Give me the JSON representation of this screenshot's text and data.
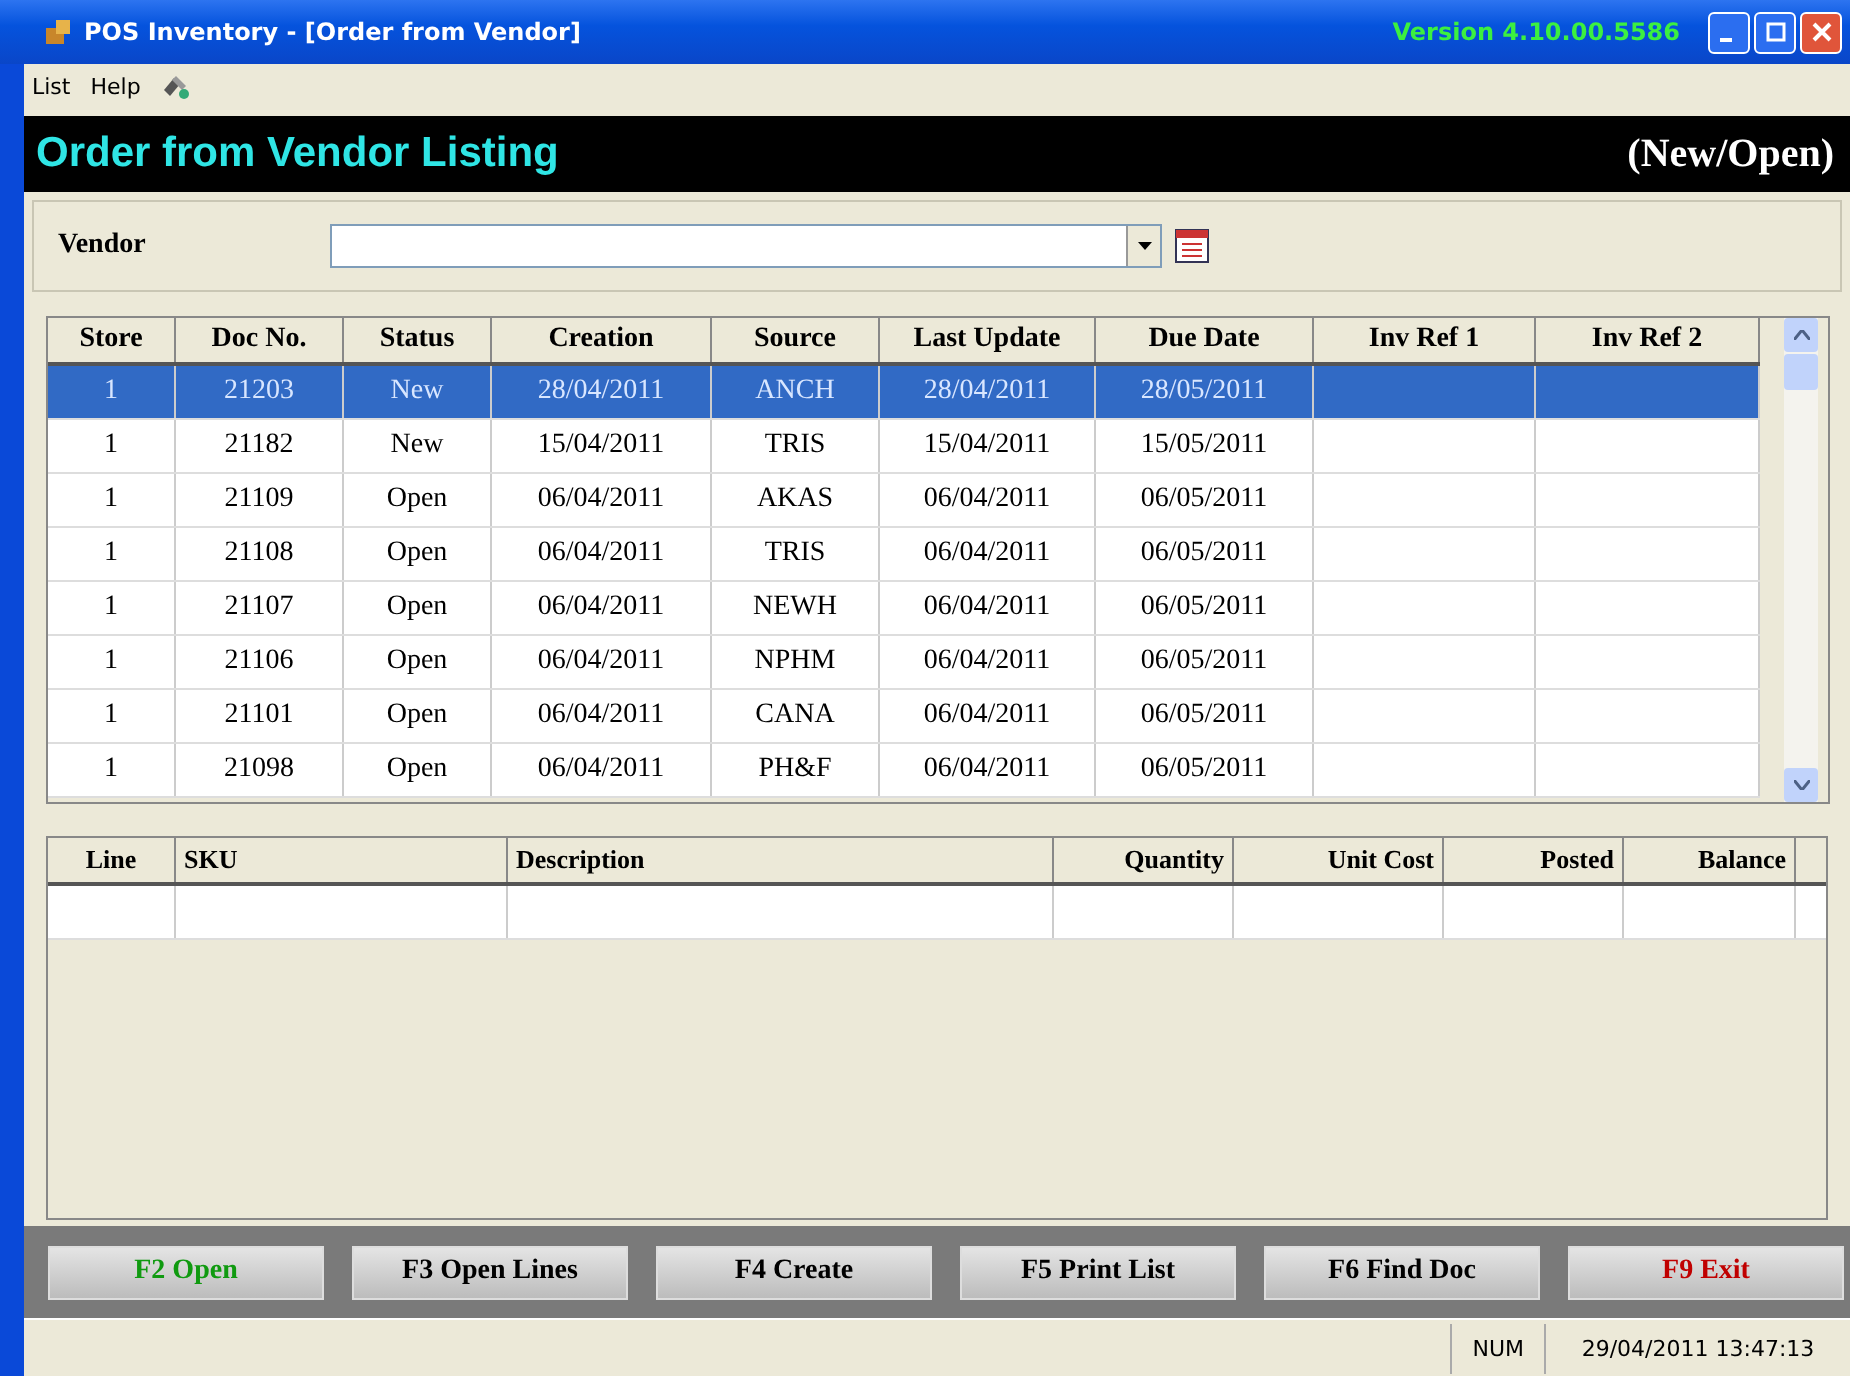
{
  "window": {
    "title": "POS Inventory - [Order from Vendor]",
    "version": "Version 4.10.00.5586"
  },
  "menu": [
    "List",
    "Help"
  ],
  "header": {
    "title": "Order from Vendor Listing",
    "mode": "(New/Open)"
  },
  "vendor": {
    "label": "Vendor"
  },
  "orders": {
    "columns": [
      "Store",
      "Doc No.",
      "Status",
      "Creation",
      "Source",
      "Last Update",
      "Due Date",
      "Inv Ref 1",
      "Inv Ref 2"
    ],
    "rows": [
      {
        "selected": true,
        "cells": [
          "1",
          "21203",
          "New",
          "28/04/2011",
          "ANCH",
          "28/04/2011",
          "28/05/2011"
        ]
      },
      {
        "selected": false,
        "cells": [
          "1",
          "21182",
          "New",
          "15/04/2011",
          "TRIS",
          "15/04/2011",
          "15/05/2011"
        ]
      },
      {
        "selected": false,
        "cells": [
          "1",
          "21109",
          "Open",
          "06/04/2011",
          "AKAS",
          "06/04/2011",
          "06/05/2011"
        ]
      },
      {
        "selected": false,
        "cells": [
          "1",
          "21108",
          "Open",
          "06/04/2011",
          "TRIS",
          "06/04/2011",
          "06/05/2011"
        ]
      },
      {
        "selected": false,
        "cells": [
          "1",
          "21107",
          "Open",
          "06/04/2011",
          "NEWH",
          "06/04/2011",
          "06/05/2011"
        ]
      },
      {
        "selected": false,
        "cells": [
          "1",
          "21106",
          "Open",
          "06/04/2011",
          "NPHM",
          "06/04/2011",
          "06/05/2011"
        ]
      },
      {
        "selected": false,
        "cells": [
          "1",
          "21101",
          "Open",
          "06/04/2011",
          "CANA",
          "06/04/2011",
          "06/05/2011"
        ]
      },
      {
        "selected": false,
        "cells": [
          "1",
          "21098",
          "Open",
          "06/04/2011",
          "PH&F",
          "06/04/2011",
          "06/05/2011"
        ]
      }
    ]
  },
  "lines": {
    "columns": [
      "Line",
      "SKU",
      "Description",
      "Quantity",
      "Unit Cost",
      "Posted",
      "Balance"
    ]
  },
  "buttons": [
    {
      "label": "F2 Open",
      "color": "#109a10"
    },
    {
      "label": "F3 Open Lines",
      "color": "#000000"
    },
    {
      "label": "F4 Create",
      "color": "#000000"
    },
    {
      "label": "F5 Print List",
      "color": "#000000"
    },
    {
      "label": "F6 Find Doc",
      "color": "#000000"
    },
    {
      "label": "F9 Exit",
      "color": "#c00000"
    }
  ],
  "status_bar": {
    "num": "NUM",
    "datetime": "29/04/2011 13:47:13"
  }
}
